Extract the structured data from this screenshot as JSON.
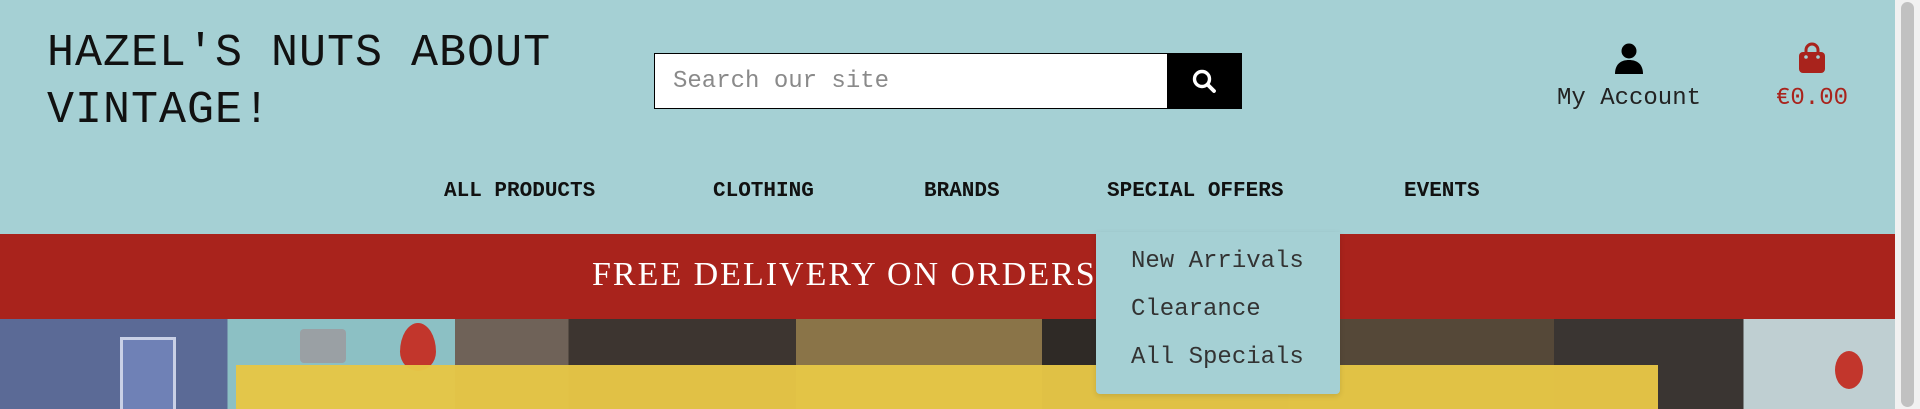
{
  "site": {
    "logo_line1": "HAZEL'S NUTS ABOUT",
    "logo_line2": "VINTAGE!"
  },
  "search": {
    "placeholder": "Search our site",
    "value": ""
  },
  "account": {
    "label": "My Account",
    "icon": "user-icon"
  },
  "cart": {
    "total": "€0.00",
    "icon": "shopping-bag-icon"
  },
  "nav": {
    "items": [
      {
        "label": "ALL PRODUCTS"
      },
      {
        "label": "CLOTHING"
      },
      {
        "label": "BRANDS"
      },
      {
        "label": "SPECIAL OFFERS"
      },
      {
        "label": "EVENTS"
      }
    ]
  },
  "dropdown": {
    "parent": "SPECIAL OFFERS",
    "items": [
      {
        "label": "New Arrivals"
      },
      {
        "label": "Clearance"
      },
      {
        "label": "All Specials"
      }
    ]
  },
  "banner": {
    "text": "FREE DELIVERY ON ORDERS"
  },
  "colors": {
    "header_bg": "#a5d0d4",
    "brand_red": "#a9231c",
    "highlight_yellow": "#e6c646"
  }
}
